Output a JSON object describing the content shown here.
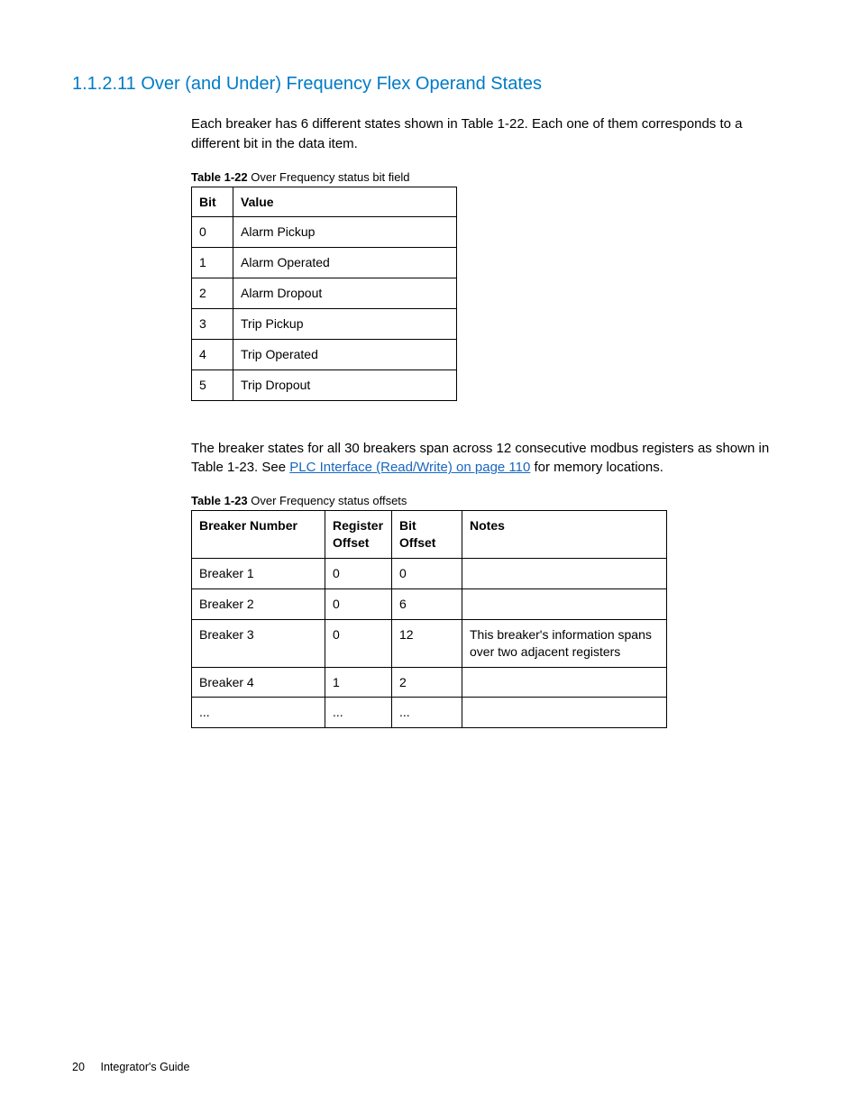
{
  "heading": "1.1.2.11 Over (and Under) Frequency Flex Operand States",
  "para1": "Each breaker has 6 different states shown in Table 1-22. Each one of them corresponds to a different bit in the data item.",
  "table22": {
    "caption_label": "Table 1-22",
    "caption_text": "  Over Frequency status bit field",
    "headers": [
      "Bit",
      "Value"
    ],
    "rows": [
      [
        "0",
        "Alarm Pickup"
      ],
      [
        "1",
        "Alarm Operated"
      ],
      [
        "2",
        "Alarm Dropout"
      ],
      [
        "3",
        "Trip Pickup"
      ],
      [
        "4",
        "Trip Operated"
      ],
      [
        "5",
        "Trip Dropout"
      ]
    ]
  },
  "para2_pre": "The breaker states for all 30 breakers span across 12 consecutive modbus registers as shown in Table 1-23. See ",
  "para2_link": "PLC Interface (Read/Write) on page 110",
  "para2_post": " for memory locations.",
  "table23": {
    "caption_label": "Table 1-23",
    "caption_text": "  Over Frequency status offsets",
    "headers": [
      "Breaker Number",
      "Register Offset",
      "Bit Offset",
      "Notes"
    ],
    "rows": [
      [
        "Breaker 1",
        "0",
        "0",
        ""
      ],
      [
        "Breaker 2",
        "0",
        "6",
        ""
      ],
      [
        "Breaker 3",
        "0",
        "12",
        "This breaker's information spans over two adjacent registers"
      ],
      [
        "Breaker 4",
        "1",
        "2",
        ""
      ],
      [
        "...",
        "...",
        "...",
        ""
      ]
    ]
  },
  "footer": {
    "page": "20",
    "label": "Integrator's Guide"
  }
}
